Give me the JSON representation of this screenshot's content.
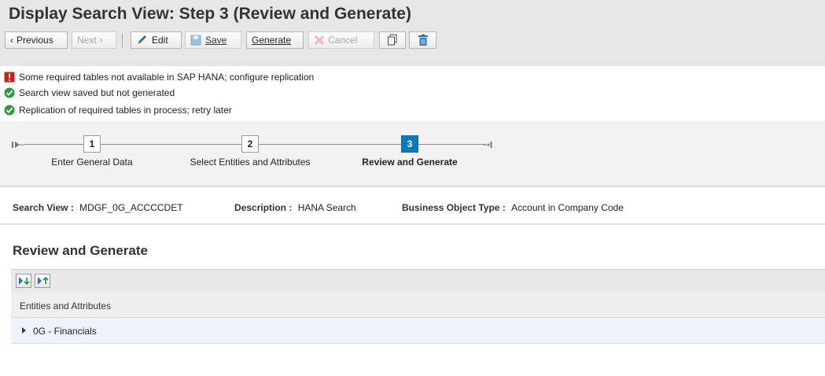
{
  "header": {
    "title": "Display Search View: Step 3  (Review and Generate)",
    "toolbar": {
      "previous_label": "Previous",
      "next_label": "Next",
      "edit_label": "Edit",
      "save_label": "Save",
      "generate_label": "Generate",
      "cancel_label": "Cancel"
    }
  },
  "messages": [
    {
      "type": "error",
      "icon": "error-icon",
      "text": "Some required tables not available in SAP HANA; configure replication"
    },
    {
      "type": "success",
      "icon": "success-icon",
      "text": "Search view saved but not generated"
    },
    {
      "type": "success",
      "icon": "success-icon",
      "text": "Replication of required tables in process; retry later"
    }
  ],
  "roadmap": {
    "steps": [
      {
        "number": "1",
        "label": "Enter General Data",
        "active": false
      },
      {
        "number": "2",
        "label": "Select Entities and Attributes",
        "active": false
      },
      {
        "number": "3",
        "label": "Review and Generate",
        "active": true
      }
    ]
  },
  "info": {
    "search_view_label": "Search View :",
    "search_view_value": "MDGF_0G_ACCCCDET",
    "description_label": "Description :",
    "description_value": "HANA Search",
    "bo_type_label": "Business Object Type :",
    "bo_type_value": "Account in Company Code"
  },
  "review": {
    "title": "Review and Generate",
    "column_header": "Entities and Attributes",
    "rows": [
      {
        "label": "0G - Financials",
        "expanded": false
      }
    ]
  },
  "colors": {
    "active_step": "#0a7ab8",
    "error": "#cc1f1f",
    "success": "#2e9a3a",
    "toolbar_icon": "#2a6fb0"
  }
}
